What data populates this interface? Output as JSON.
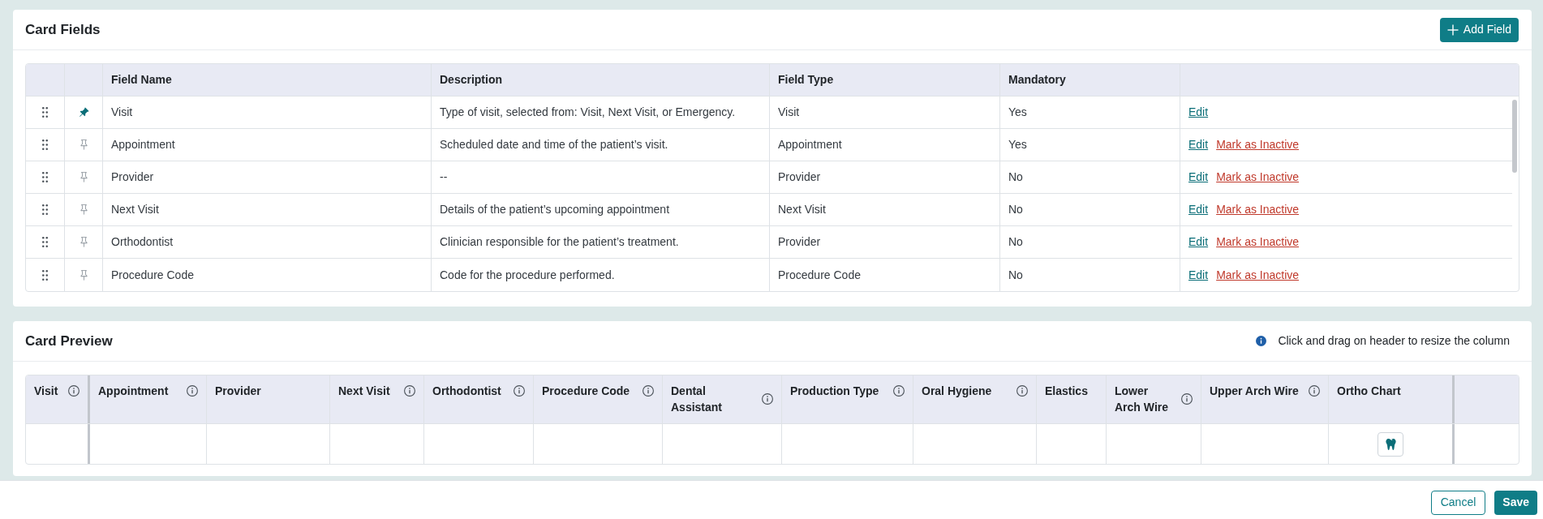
{
  "card_fields": {
    "title": "Card Fields",
    "add_button": "Add Field",
    "columns": [
      "Field Name",
      "Description",
      "Field Type",
      "Mandatory"
    ],
    "rows": [
      {
        "pinned": true,
        "field_name": "Visit",
        "description": "Type of visit, selected from: Visit, Next Visit, or Emergency.",
        "field_type": "Visit",
        "mandatory": "Yes",
        "actions": [
          {
            "kind": "edit",
            "label": "Edit"
          }
        ]
      },
      {
        "pinned": false,
        "field_name": "Appointment",
        "description": "Scheduled date and time of the patient’s visit.",
        "field_type": "Appointment",
        "mandatory": "Yes",
        "actions": [
          {
            "kind": "edit",
            "label": "Edit"
          },
          {
            "kind": "deactivate",
            "label": "Mark as Inactive"
          }
        ]
      },
      {
        "pinned": false,
        "field_name": "Provider",
        "description": "--",
        "field_type": "Provider",
        "mandatory": "No",
        "actions": [
          {
            "kind": "edit",
            "label": "Edit"
          },
          {
            "kind": "deactivate",
            "label": "Mark as Inactive"
          }
        ]
      },
      {
        "pinned": false,
        "field_name": "Next Visit",
        "description": "Details of the patient’s upcoming appointment",
        "field_type": "Next Visit",
        "mandatory": "No",
        "actions": [
          {
            "kind": "edit",
            "label": "Edit"
          },
          {
            "kind": "deactivate",
            "label": "Mark as Inactive"
          }
        ]
      },
      {
        "pinned": false,
        "field_name": "Orthodontist",
        "description": "Clinician responsible for the patient’s treatment.",
        "field_type": "Provider",
        "mandatory": "No",
        "actions": [
          {
            "kind": "edit",
            "label": "Edit"
          },
          {
            "kind": "deactivate",
            "label": "Mark as Inactive"
          }
        ]
      },
      {
        "pinned": false,
        "field_name": "Procedure Code",
        "description": "Code for the procedure performed.",
        "field_type": "Procedure Code",
        "mandatory": "No",
        "actions": [
          {
            "kind": "edit",
            "label": "Edit"
          },
          {
            "kind": "deactivate",
            "label": "Mark as Inactive"
          }
        ]
      }
    ]
  },
  "card_preview": {
    "title": "Card Preview",
    "hint": "Click and drag on header to resize the column",
    "columns": [
      {
        "label": "Visit",
        "info": true,
        "frozen": true,
        "kind": "text"
      },
      {
        "label": "Appointment",
        "info": true,
        "frozen": false,
        "kind": "text"
      },
      {
        "label": "Provider",
        "info": false,
        "frozen": false,
        "kind": "text"
      },
      {
        "label": "Next Visit",
        "info": true,
        "frozen": false,
        "kind": "text"
      },
      {
        "label": "Orthodontist",
        "info": true,
        "frozen": false,
        "kind": "text"
      },
      {
        "label": "Procedure Code",
        "info": true,
        "frozen": false,
        "kind": "text"
      },
      {
        "label": "Dental Assistant",
        "info": true,
        "frozen": false,
        "kind": "text"
      },
      {
        "label": "Production Type",
        "info": true,
        "frozen": false,
        "kind": "text"
      },
      {
        "label": "Oral Hygiene",
        "info": true,
        "frozen": false,
        "kind": "text"
      },
      {
        "label": "Elastics",
        "info": false,
        "frozen": false,
        "kind": "text"
      },
      {
        "label": "Lower Arch Wire",
        "info": true,
        "frozen": false,
        "kind": "text"
      },
      {
        "label": "Upper Arch Wire",
        "info": true,
        "frozen": false,
        "kind": "text"
      },
      {
        "label": "Ortho Chart",
        "info": false,
        "frozen": true,
        "kind": "chart"
      }
    ]
  },
  "footer": {
    "buttons": [
      {
        "kind": "secondary",
        "label": "Cancel"
      },
      {
        "kind": "primary",
        "label": "Save"
      }
    ]
  }
}
